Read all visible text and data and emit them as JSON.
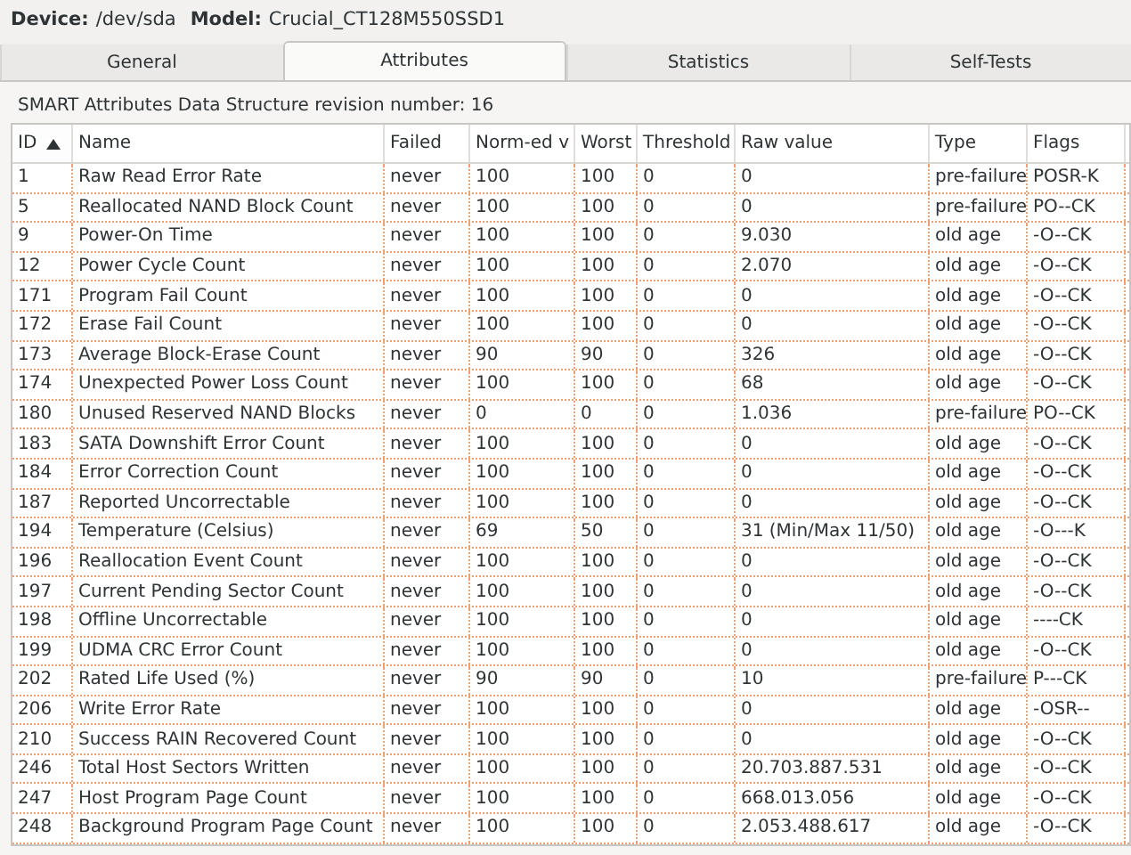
{
  "device": {
    "device_label": "Device:",
    "device_value": "/dev/sda",
    "model_label": "Model:",
    "model_value": "Crucial_CT128M550SSD1"
  },
  "tabs": [
    {
      "label": "General",
      "selected": false
    },
    {
      "label": "Attributes",
      "selected": true
    },
    {
      "label": "Statistics",
      "selected": false
    },
    {
      "label": "Self-Tests",
      "selected": false
    }
  ],
  "revision": "SMART Attributes Data Structure revision number: 16",
  "table": {
    "columns": [
      {
        "label": "ID",
        "sorted": true
      },
      {
        "label": "Name",
        "sorted": false
      },
      {
        "label": "Failed",
        "sorted": false
      },
      {
        "label": "Norm-ed v",
        "sorted": false
      },
      {
        "label": "Worst",
        "sorted": false
      },
      {
        "label": "Threshold",
        "sorted": false
      },
      {
        "label": "Raw value",
        "sorted": false
      },
      {
        "label": "Type",
        "sorted": false
      },
      {
        "label": "Flags",
        "sorted": false
      }
    ],
    "rows": [
      [
        "1",
        "Raw Read Error Rate",
        "never",
        "100",
        "100",
        "0",
        "0",
        "pre-failure",
        "POSR-K"
      ],
      [
        "5",
        "Reallocated NAND Block Count",
        "never",
        "100",
        "100",
        "0",
        "0",
        "pre-failure",
        "PO--CK"
      ],
      [
        "9",
        "Power-On Time",
        "never",
        "100",
        "100",
        "0",
        "9.030",
        "old age",
        "-O--CK"
      ],
      [
        "12",
        "Power Cycle Count",
        "never",
        "100",
        "100",
        "0",
        "2.070",
        "old age",
        "-O--CK"
      ],
      [
        "171",
        "Program Fail Count",
        "never",
        "100",
        "100",
        "0",
        "0",
        "old age",
        "-O--CK"
      ],
      [
        "172",
        "Erase Fail Count",
        "never",
        "100",
        "100",
        "0",
        "0",
        "old age",
        "-O--CK"
      ],
      [
        "173",
        "Average Block-Erase Count",
        "never",
        "90",
        "90",
        "0",
        "326",
        "old age",
        "-O--CK"
      ],
      [
        "174",
        "Unexpected Power Loss Count",
        "never",
        "100",
        "100",
        "0",
        "68",
        "old age",
        "-O--CK"
      ],
      [
        "180",
        "Unused Reserved NAND Blocks",
        "never",
        "0",
        "0",
        "0",
        "1.036",
        "pre-failure",
        "PO--CK"
      ],
      [
        "183",
        "SATA Downshift Error Count",
        "never",
        "100",
        "100",
        "0",
        "0",
        "old age",
        "-O--CK"
      ],
      [
        "184",
        "Error Correction Count",
        "never",
        "100",
        "100",
        "0",
        "0",
        "old age",
        "-O--CK"
      ],
      [
        "187",
        "Reported Uncorrectable",
        "never",
        "100",
        "100",
        "0",
        "0",
        "old age",
        "-O--CK"
      ],
      [
        "194",
        "Temperature (Celsius)",
        "never",
        "69",
        "50",
        "0",
        "31 (Min/Max 11/50)",
        "old age",
        "-O---K"
      ],
      [
        "196",
        "Reallocation Event Count",
        "never",
        "100",
        "100",
        "0",
        "0",
        "old age",
        "-O--CK"
      ],
      [
        "197",
        "Current Pending Sector Count",
        "never",
        "100",
        "100",
        "0",
        "0",
        "old age",
        "-O--CK"
      ],
      [
        "198",
        "Offline Uncorrectable",
        "never",
        "100",
        "100",
        "0",
        "0",
        "old age",
        "----CK"
      ],
      [
        "199",
        "UDMA CRC Error Count",
        "never",
        "100",
        "100",
        "0",
        "0",
        "old age",
        "-O--CK"
      ],
      [
        "202",
        "Rated Life Used (%)",
        "never",
        "90",
        "90",
        "0",
        "10",
        "pre-failure",
        "P---CK"
      ],
      [
        "206",
        "Write Error Rate",
        "never",
        "100",
        "100",
        "0",
        "0",
        "old age",
        "-OSR--"
      ],
      [
        "210",
        "Success RAIN Recovered Count",
        "never",
        "100",
        "100",
        "0",
        "0",
        "old age",
        "-O--CK"
      ],
      [
        "246",
        "Total Host Sectors Written",
        "never",
        "100",
        "100",
        "0",
        "20.703.887.531",
        "old age",
        "-O--CK"
      ],
      [
        "247",
        "Host Program Page Count",
        "never",
        "100",
        "100",
        "0",
        "668.013.056",
        "old age",
        "-O--CK"
      ],
      [
        "248",
        "Background Program Page Count",
        "never",
        "100",
        "100",
        "0",
        "2.053.488.617",
        "old age",
        "-O--CK"
      ]
    ]
  }
}
